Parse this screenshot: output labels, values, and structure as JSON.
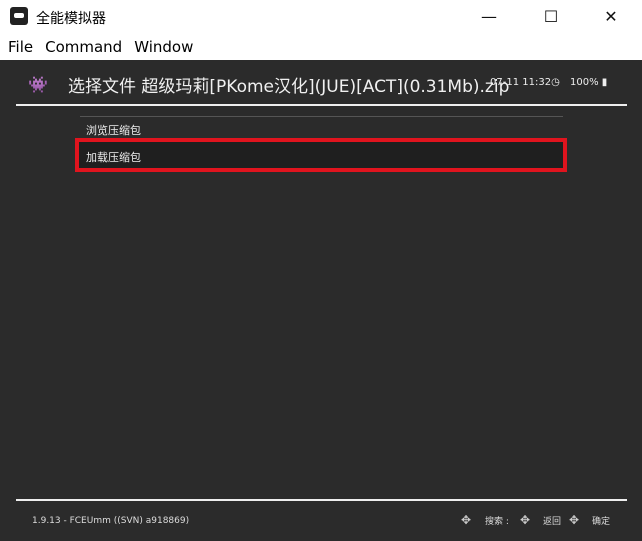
{
  "window": {
    "title": "全能模拟器",
    "minimize": "—",
    "maximize": "☐",
    "close": "✕"
  },
  "menu": [
    "File",
    "Command",
    "Window"
  ],
  "header": {
    "title": "选择文件 超级玛莉[PKome汉化](JUE)[ACT](0.31Mb).zip",
    "clock": "07-11 11:32",
    "battery": "100%"
  },
  "items": [
    {
      "label": "浏览压缩包"
    },
    {
      "label": "加载压缩包",
      "selected": true
    }
  ],
  "footer": {
    "version": "1.9.13 - FCEUmm ((SVN) a918869)",
    "search": "搜索 :",
    "back": "返回",
    "ok": "确定"
  },
  "colors": {
    "background": "#2b2b2b",
    "highlight_border": "#e0141e"
  }
}
